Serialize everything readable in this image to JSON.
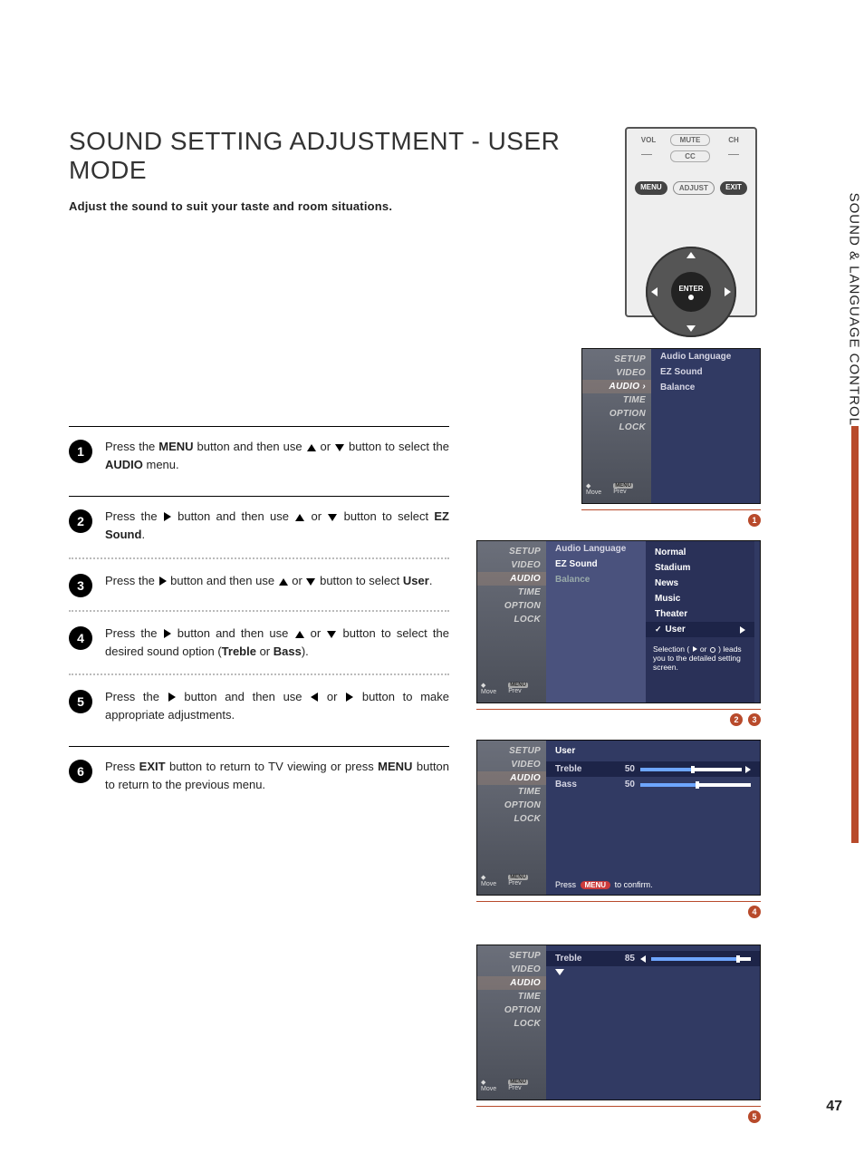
{
  "title": "SOUND SETTING ADJUSTMENT - USER MODE",
  "subtitle": "Adjust the sound to suit your taste and room situations.",
  "section_side_title": "SOUND & LANGUAGE CONTROL",
  "page_number": "47",
  "remote": {
    "vol": "VOL",
    "mute": "MUTE",
    "cc": "CC",
    "ch": "CH",
    "menu": "MENU",
    "adjust": "ADJUST",
    "exit": "EXIT",
    "enter": "ENTER"
  },
  "steps": {
    "s1": {
      "prefix": "Press the ",
      "menu": "MENU",
      "middle": " button and then use ",
      "tail": " button to select the ",
      "target": "AUDIO",
      "end": " menu."
    },
    "s2": {
      "prefix": "Press the ",
      "middle": " button and then use ",
      "tail": " button to select ",
      "target": "EZ Sound",
      "end": "."
    },
    "s3": {
      "prefix": "Press the ",
      "middle": " button and then use ",
      "tail": " button to select ",
      "target": "User",
      "end": "."
    },
    "s4": {
      "prefix": "Press the ",
      "middle": " button and then use ",
      "tail": " button to select the desired sound option (",
      "opt1": "Treble",
      "or": " or ",
      "opt2": "Bass",
      "end": ")."
    },
    "s5": {
      "prefix": "Press the ",
      "middle": " button and then use ",
      "tail": " button to make appropriate adjustments."
    },
    "s6": {
      "a": "Press ",
      "exit": "EXIT",
      "b": " button to return to TV viewing or press ",
      "menu": "MENU",
      "c": " button to return to the previous menu."
    }
  },
  "osd_sidebar": {
    "setup": "SETUP",
    "video": "VIDEO",
    "audio": "AUDIO",
    "time": "TIME",
    "option": "OPTION",
    "lock": "LOCK",
    "footer_move": "Move",
    "footer_prev": "Prev",
    "footer_menu_chip": "MENU"
  },
  "osd1": {
    "audio_lang": "Audio Language",
    "ez_sound": "EZ Sound",
    "balance": "Balance"
  },
  "osd2": {
    "c2": {
      "audio_lang": "Audio Language",
      "ez_sound": "EZ Sound",
      "balance": "Balance"
    },
    "opts": {
      "normal": "Normal",
      "stadium": "Stadium",
      "news": "News",
      "music": "Music",
      "theater": "Theater",
      "user": "User"
    },
    "note": "Selection ( ▶ or ⊙ ) leads you to the detailed setting screen."
  },
  "osd3": {
    "user": "User",
    "treble": {
      "label": "Treble",
      "value": "50",
      "percent": 50
    },
    "bass": {
      "label": "Bass",
      "value": "50",
      "percent": 50
    },
    "hint_a": "Press ",
    "hint_pill": "MENU",
    "hint_b": " to confirm."
  },
  "osd4": {
    "treble": {
      "label": "Treble",
      "value": "85",
      "percent": 85
    }
  },
  "annotations": {
    "a1": "1",
    "a2": "2",
    "a3": "3",
    "a4": "4",
    "a5": "5"
  }
}
